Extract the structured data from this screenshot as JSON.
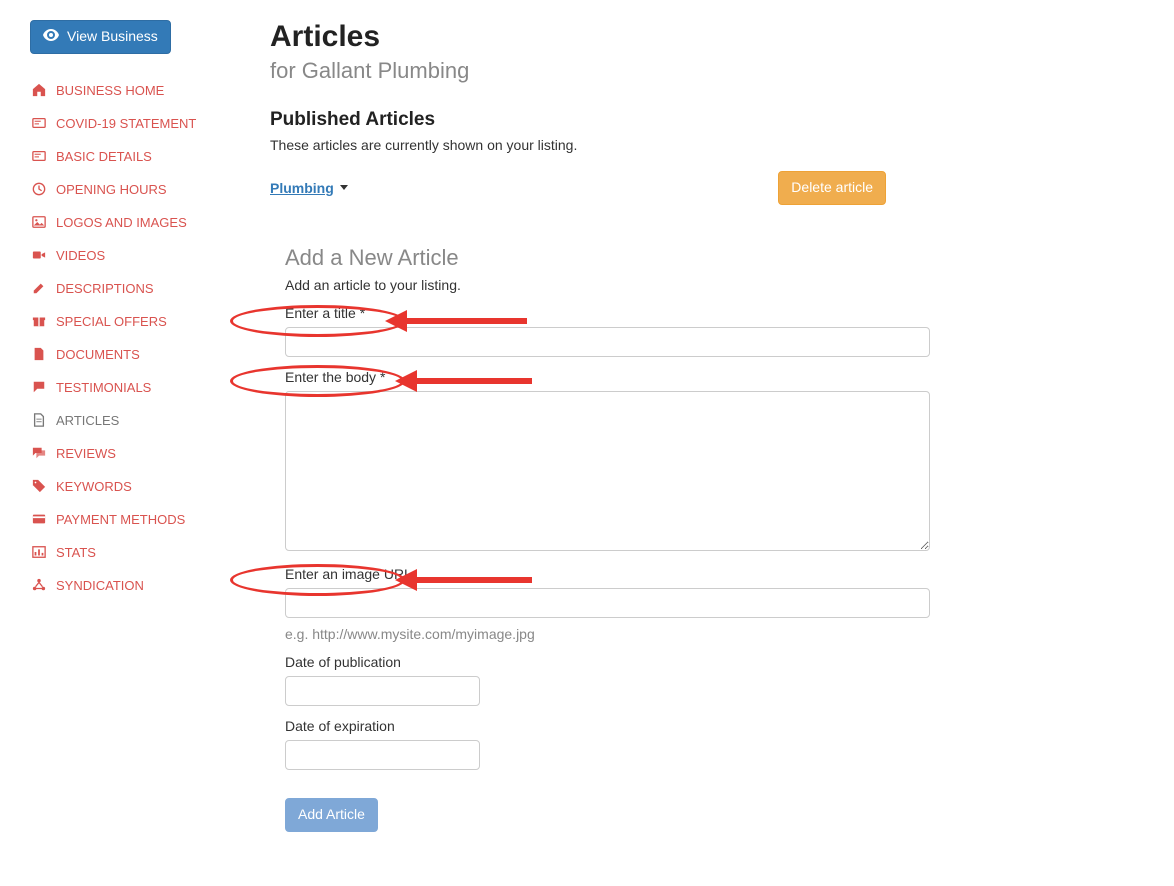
{
  "view_business_label": "View Business",
  "sidebar": {
    "items": [
      {
        "label": "BUSINESS HOME",
        "icon": "home"
      },
      {
        "label": "COVID-19 STATEMENT",
        "icon": "card"
      },
      {
        "label": "BASIC DETAILS",
        "icon": "card"
      },
      {
        "label": "OPENING HOURS",
        "icon": "clock"
      },
      {
        "label": "LOGOS AND IMAGES",
        "icon": "image"
      },
      {
        "label": "VIDEOS",
        "icon": "video"
      },
      {
        "label": "DESCRIPTIONS",
        "icon": "pencil"
      },
      {
        "label": "SPECIAL OFFERS",
        "icon": "gift"
      },
      {
        "label": "DOCUMENTS",
        "icon": "file"
      },
      {
        "label": "TESTIMONIALS",
        "icon": "comment"
      },
      {
        "label": "ARTICLES",
        "icon": "file-alt",
        "active": true
      },
      {
        "label": "REVIEWS",
        "icon": "comments"
      },
      {
        "label": "KEYWORDS",
        "icon": "tag"
      },
      {
        "label": "PAYMENT METHODS",
        "icon": "credit"
      },
      {
        "label": "STATS",
        "icon": "chart"
      },
      {
        "label": "SYNDICATION",
        "icon": "share"
      }
    ]
  },
  "page": {
    "title": "Articles",
    "subtitle": "for Gallant Plumbing"
  },
  "published": {
    "title": "Published Articles",
    "subtext": "These articles are currently shown on your listing.",
    "article_link": "Plumbing ",
    "delete_label": "Delete article"
  },
  "form": {
    "title": "Add a New Article",
    "subtext": "Add an article to your listing.",
    "title_label": "Enter a title *",
    "body_label": "Enter the body *",
    "image_label": "Enter an image URL",
    "image_help": "e.g. http://www.mysite.com/myimage.jpg",
    "pub_date_label": "Date of publication",
    "exp_date_label": "Date of expiration",
    "submit_label": "Add Article"
  }
}
